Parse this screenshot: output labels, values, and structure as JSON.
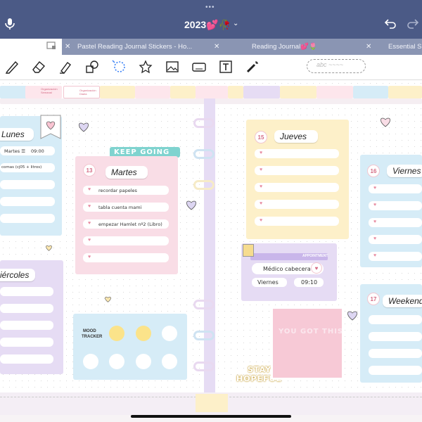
{
  "statusbar": {
    "dots": "•••"
  },
  "header": {
    "title": "2023💕🥀",
    "chevron": "⌄"
  },
  "tabs": [
    {
      "close": "✕",
      "label": ""
    },
    {
      "close": "✕",
      "label": "Pastel Reading Journal Stickers - Ho..."
    },
    {
      "close": "✕",
      "label": "Reading Journal💕🌷"
    },
    {
      "close": "✕",
      "label": "Essential S"
    }
  ],
  "toolbar": {
    "tools": [
      "pen-icon",
      "eraser-icon",
      "highlighter-icon",
      "shapes-icon",
      "lasso-icon",
      "sticker-icon",
      "image-icon",
      "keyboard-icon",
      "text-icon",
      "laser-icon"
    ],
    "lasso_hint": "abc ~~~~"
  },
  "ribbons": {
    "left": [
      "Organización Semanal",
      "Organización Diaria"
    ],
    "right": []
  },
  "planner": {
    "lunes": {
      "label": "Lunes",
      "entries": [
        {
          "text": "Martes ☰",
          "time": "09:00"
        },
        {
          "text": "comas (cj05 + litros)"
        }
      ]
    },
    "martes": {
      "num": "13",
      "label": "Martes",
      "entries": [
        "recordar papeles",
        "tabla cuenta mami",
        "empezar Hamlet nº2 (Libro)"
      ]
    },
    "miercoles": {
      "label": "iércoles"
    },
    "jueves": {
      "num": "15",
      "label": "Jueves"
    },
    "viernes": {
      "num": "16",
      "label": "Viernes"
    },
    "weekend": {
      "num": "17",
      "label": "Weekend"
    }
  },
  "stickers": {
    "keep_going": "KEEP GOING",
    "stay": "STAY",
    "hopeful": "HOPEFUL",
    "you_got_this": "YOU GOT THIS"
  },
  "mood": {
    "title_line1": "MOOD",
    "title_line2": "TRACKER"
  },
  "appointment": {
    "header": "APPOINTMENT",
    "who": "Médico cabecera",
    "day": "Viernes",
    "time": "09:10"
  },
  "colors": {
    "topbar": "#4b5a86",
    "tabs": "#8a95b3",
    "pink": "#f9dde6",
    "blue": "#d6ecf7",
    "yellow": "#fdf0c9",
    "lavender": "#e6dcf4"
  }
}
